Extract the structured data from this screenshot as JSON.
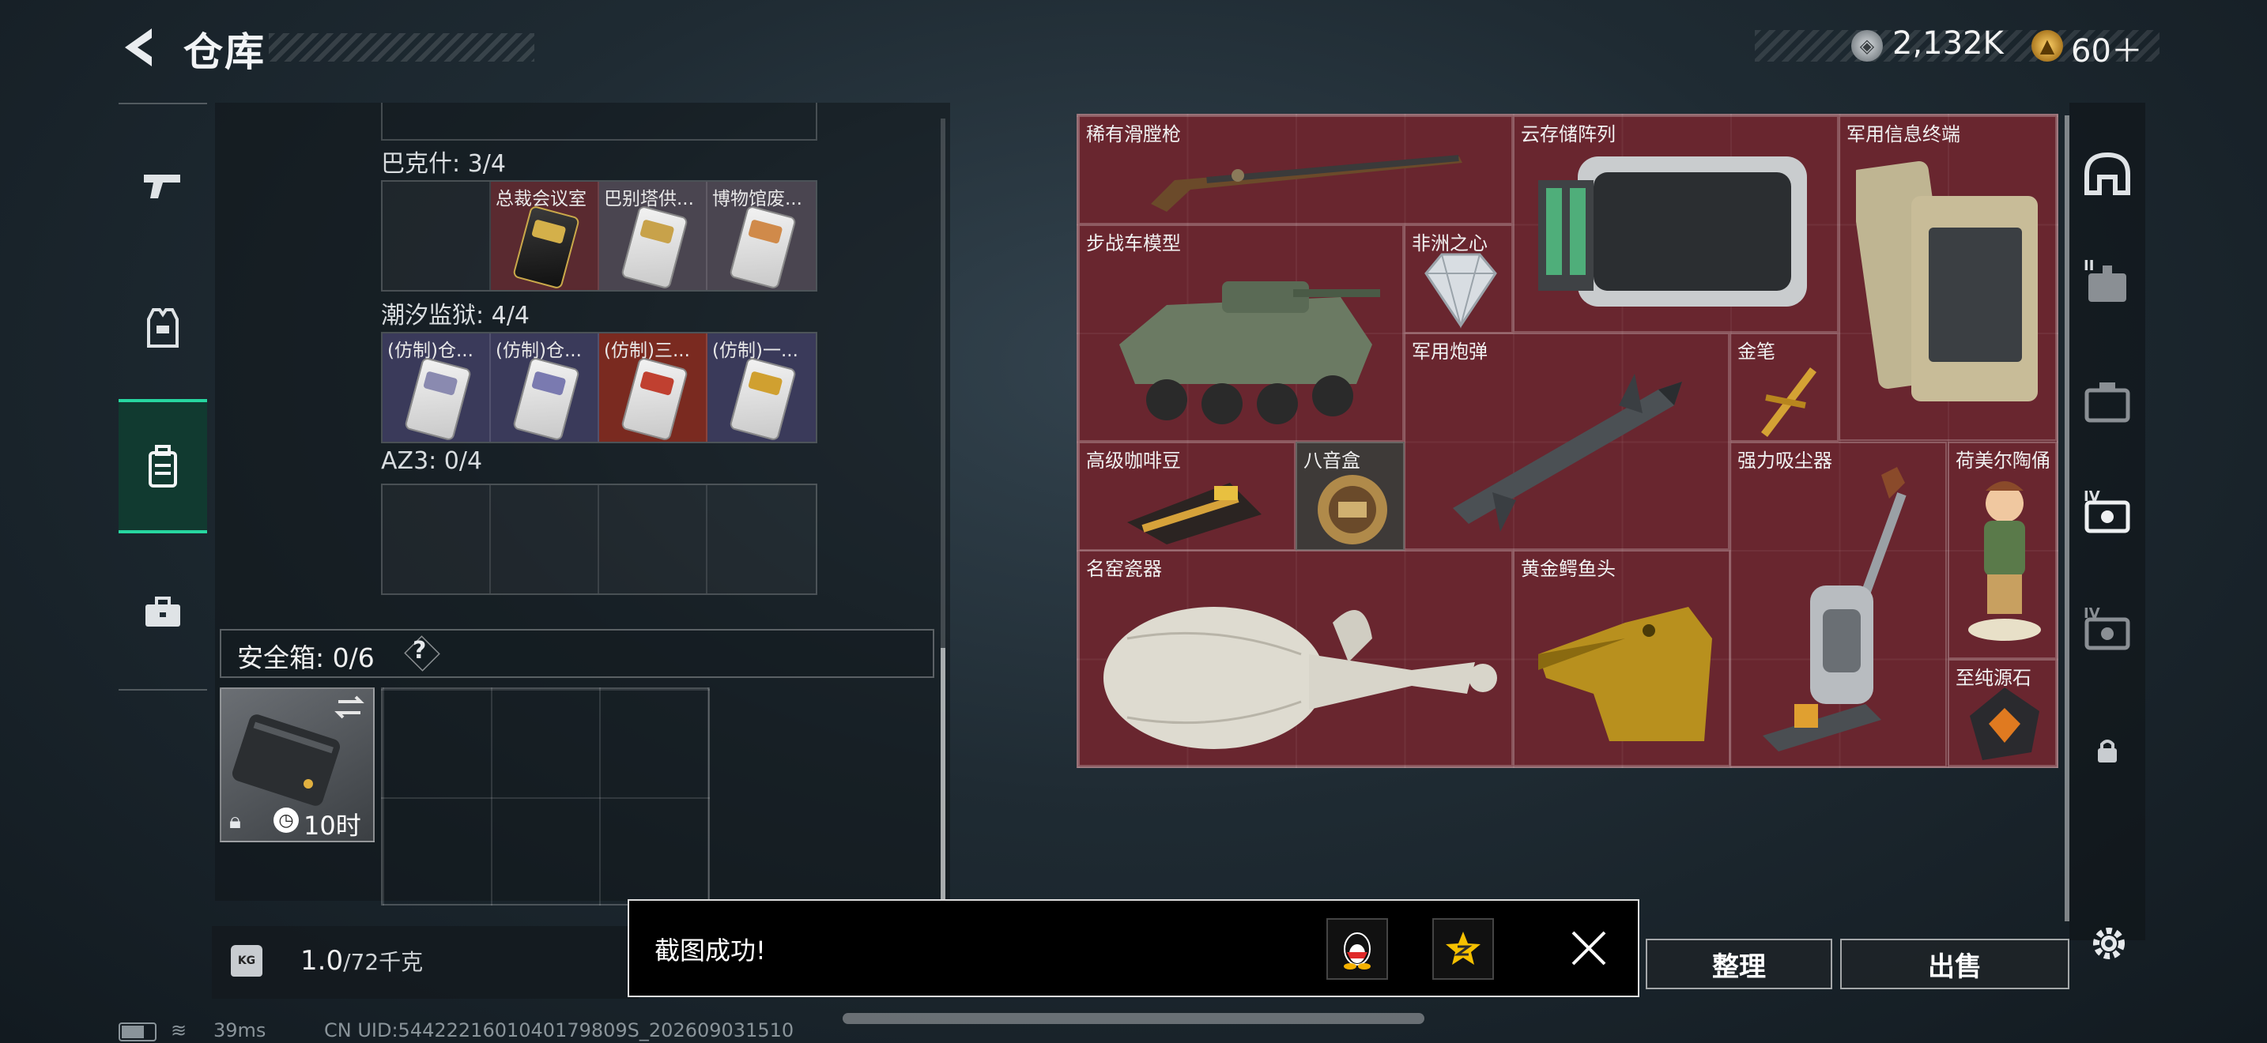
{
  "header": {
    "title": "仓库"
  },
  "currency": {
    "silver_value": "2,132K",
    "gold_value": "60＋"
  },
  "left_nav": [
    {
      "name": "weapons"
    },
    {
      "name": "equipment"
    },
    {
      "name": "backpack",
      "active": true
    },
    {
      "name": "briefcase"
    }
  ],
  "stash": {
    "sections": [
      {
        "label": "巴克什: 3/4",
        "cells": [
          {
            "name": ""
          },
          {
            "name": "总裁会议室",
            "color": "red"
          },
          {
            "name": "巴别塔供...",
            "color": "gray"
          },
          {
            "name": "博物馆废...",
            "color": "gray"
          }
        ]
      },
      {
        "label": "潮汐监狱: 4/4",
        "cells": [
          {
            "name": "(仿制)仓...",
            "color": "purple"
          },
          {
            "name": "(仿制)仓...",
            "color": "purple"
          },
          {
            "name": "(仿制)三...",
            "color": "orange"
          },
          {
            "name": "(仿制)一...",
            "color": "purple"
          }
        ]
      },
      {
        "label": "AZ3: 0/4",
        "cells": [
          {
            "name": ""
          },
          {
            "name": ""
          },
          {
            "name": ""
          },
          {
            "name": ""
          }
        ]
      }
    ]
  },
  "safe_box": {
    "label": "安全箱: 0/6",
    "help": "?",
    "timer": "10时"
  },
  "weight": {
    "current": "1.0",
    "max": "/72千克",
    "icon_text": "KG"
  },
  "loot": {
    "items": [
      {
        "name": "稀有滑膛枪"
      },
      {
        "name": "云存储阵列"
      },
      {
        "name": "军用信息终端"
      },
      {
        "name": "步战车模型"
      },
      {
        "name": "非洲之心"
      },
      {
        "name": "军用炮弹"
      },
      {
        "name": "金笔"
      },
      {
        "name": "高级咖啡豆"
      },
      {
        "name": "八音盒"
      },
      {
        "name": "强力吸尘器"
      },
      {
        "name": "荷美尔陶俑"
      },
      {
        "name": "名窑瓷器"
      },
      {
        "name": "黄金鳄鱼头"
      },
      {
        "name": "至纯源石"
      }
    ]
  },
  "right_nav": [
    {
      "icon": "helmet-icon"
    },
    {
      "icon": "armor-ii-icon",
      "label": "II"
    },
    {
      "icon": "case-icon"
    },
    {
      "icon": "rig-iv-icon",
      "label": "IV"
    },
    {
      "icon": "rig-iv-icon-2",
      "label": "IV"
    },
    {
      "icon": "lock-icon"
    }
  ],
  "buttons": {
    "organize": "整理",
    "sell": "出售"
  },
  "toast": {
    "message": "截图成功!"
  },
  "status_bar": {
    "ping": "39ms",
    "uid": "CN UID:5442221601040179809S_202609031510"
  }
}
